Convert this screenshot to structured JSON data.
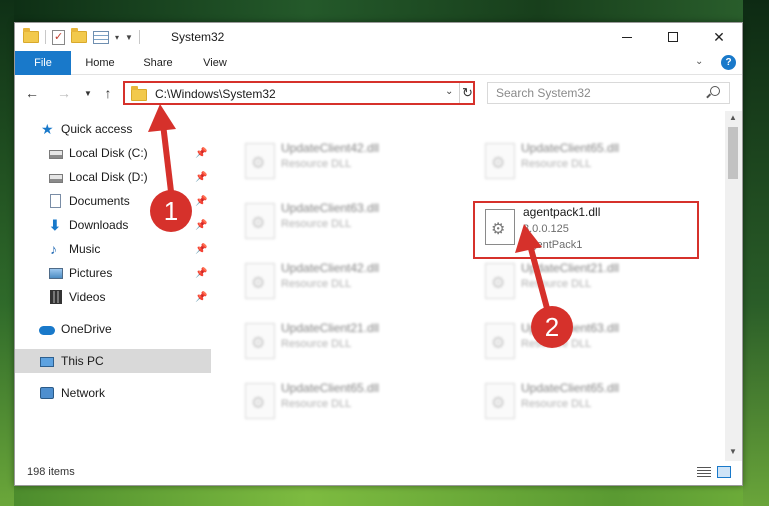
{
  "window": {
    "title": "System32"
  },
  "ribbon": {
    "tabs": [
      "File",
      "Home",
      "Share",
      "View"
    ],
    "file_color": "#1979ca"
  },
  "address": {
    "path": "C:\\Windows\\System32"
  },
  "search": {
    "placeholder": "Search System32"
  },
  "sidebar": {
    "items": [
      {
        "label": "Quick access",
        "icon": "star-icon"
      },
      {
        "label": "Local Disk (C:)",
        "icon": "drive-icon",
        "pinned": true
      },
      {
        "label": "Local Disk (D:)",
        "icon": "drive-icon",
        "pinned": true
      },
      {
        "label": "Documents",
        "icon": "document-icon",
        "pinned": true
      },
      {
        "label": "Downloads",
        "icon": "download-icon",
        "pinned": true
      },
      {
        "label": "Music",
        "icon": "music-icon",
        "pinned": true
      },
      {
        "label": "Pictures",
        "icon": "pictures-icon",
        "pinned": true
      },
      {
        "label": "Videos",
        "icon": "video-icon",
        "pinned": true
      },
      {
        "label": "OneDrive",
        "icon": "cloud-icon"
      },
      {
        "label": "This PC",
        "icon": "computer-icon",
        "selected": true
      },
      {
        "label": "Network",
        "icon": "network-icon"
      }
    ]
  },
  "files": [
    {
      "name": "UpdateClient42.dll",
      "type": "Resource DLL"
    },
    {
      "name": "UpdateClient65.dll",
      "type": "Resource DLL"
    },
    {
      "name": "UpdateClient63.dll",
      "type": "Resource DLL"
    },
    {
      "name": "UpdateClient42.dll",
      "type": "Resource DLL"
    },
    {
      "name": "UpdateClient21.dll",
      "type": "Resource DLL"
    },
    {
      "name": "UpdateClient21.dll",
      "type": "Resource DLL"
    },
    {
      "name": "UpdateClient63.dll",
      "type": "Resource DLL"
    },
    {
      "name": "UpdateClient65.dll",
      "type": "Resource DLL"
    },
    {
      "name": "UpdateClient65.dll",
      "type": "Resource DLL"
    }
  ],
  "highlighted_file": {
    "name": "agentpack1.dll",
    "version": "3.0.0.125",
    "description": "AgentPack1"
  },
  "annotations": {
    "badge1": "1",
    "badge2": "2",
    "color": "#d6312b"
  },
  "status": {
    "items_count": "198 items"
  }
}
